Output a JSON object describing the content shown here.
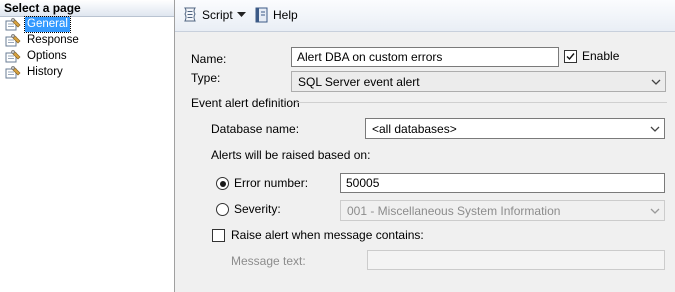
{
  "sidebar": {
    "header": "Select a page",
    "items": [
      {
        "label": "General",
        "icon": "wrench-page-icon",
        "selected": true
      },
      {
        "label": "Response",
        "icon": "wrench-page-icon",
        "selected": false
      },
      {
        "label": "Options",
        "icon": "wrench-page-icon",
        "selected": false
      },
      {
        "label": "History",
        "icon": "wrench-page-icon",
        "selected": false
      }
    ]
  },
  "toolbar": {
    "script_label": "Script",
    "help_label": "Help"
  },
  "form": {
    "name_label": "Name:",
    "name_value": "Alert DBA on custom errors",
    "enable_label": "Enable",
    "enable_checked": true,
    "type_label": "Type:",
    "type_value": "SQL Server event alert",
    "section_title": "Event alert definition",
    "database_label": "Database name:",
    "database_value": "<all databases>",
    "raised_label": "Alerts will be raised based on:",
    "error_number_label": "Error number:",
    "error_number_value": "50005",
    "error_number_selected": true,
    "severity_label": "Severity:",
    "severity_value": "001 - Miscellaneous System Information",
    "severity_selected": false,
    "raise_message_label": "Raise alert when message contains:",
    "raise_message_checked": false,
    "message_text_label": "Message text:",
    "message_text_value": ""
  },
  "colors": {
    "selection": "#3399ff",
    "form_background": "#f0f0f0",
    "disabled_text": "#8c8c8c"
  }
}
